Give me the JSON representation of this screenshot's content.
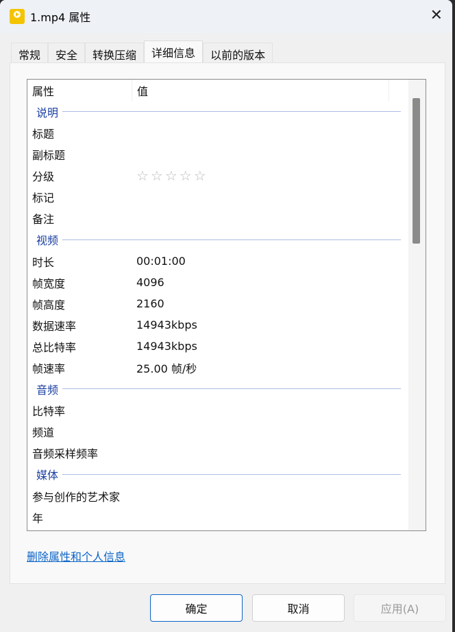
{
  "window": {
    "title": "1.mp4 属性",
    "close": "✕"
  },
  "tabs": [
    "常规",
    "安全",
    "转换压缩",
    "详细信息",
    "以前的版本"
  ],
  "list": {
    "headers": {
      "property": "属性",
      "value": "值"
    },
    "groups": [
      {
        "name": "说明",
        "rows": [
          {
            "k": "标题",
            "v": ""
          },
          {
            "k": "副标题",
            "v": ""
          },
          {
            "k": "分级",
            "v": "",
            "stars": 5
          },
          {
            "k": "标记",
            "v": ""
          },
          {
            "k": "备注",
            "v": ""
          }
        ]
      },
      {
        "name": "视频",
        "rows": [
          {
            "k": "时长",
            "v": "00:01:00"
          },
          {
            "k": "帧宽度",
            "v": "4096"
          },
          {
            "k": "帧高度",
            "v": "2160"
          },
          {
            "k": "数据速率",
            "v": "14943kbps"
          },
          {
            "k": "总比特率",
            "v": "14943kbps"
          },
          {
            "k": "帧速率",
            "v": "25.00 帧/秒"
          }
        ]
      },
      {
        "name": "音频",
        "rows": [
          {
            "k": "比特率",
            "v": ""
          },
          {
            "k": "频道",
            "v": ""
          },
          {
            "k": "音频采样频率",
            "v": ""
          }
        ]
      },
      {
        "name": "媒体",
        "rows": [
          {
            "k": "参与创作的艺术家",
            "v": ""
          },
          {
            "k": "年",
            "v": ""
          }
        ]
      }
    ],
    "rating_stars": "☆☆☆☆☆"
  },
  "link": "删除属性和个人信息",
  "buttons": {
    "ok": "确定",
    "cancel": "取消",
    "apply": "应用(A)"
  }
}
